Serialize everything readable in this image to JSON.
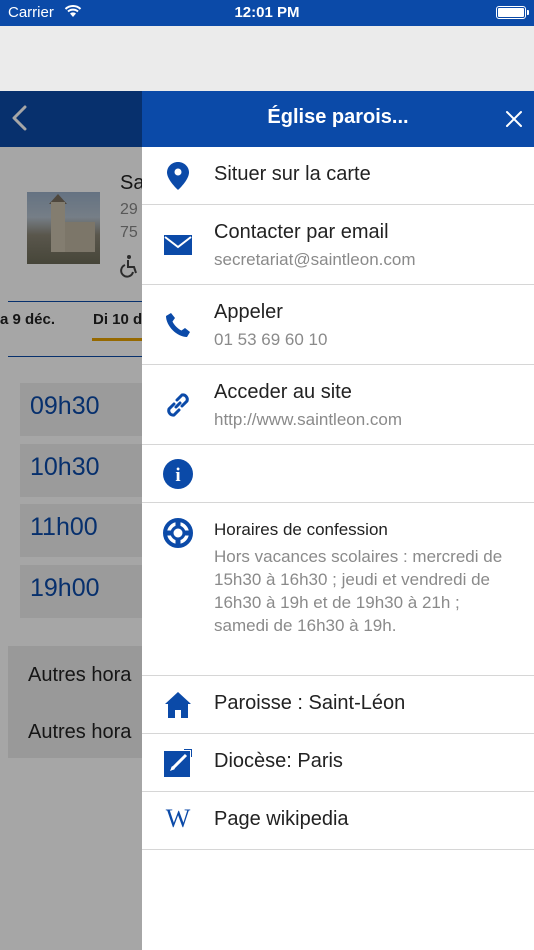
{
  "status_bar": {
    "carrier": "Carrier",
    "time": "12:01 PM"
  },
  "background": {
    "title_partial": "Sa",
    "addr_line1_partial": "29",
    "addr_line2_partial": "75",
    "tab_prev": "a 9 déc.",
    "tab_current": "Di 10 d",
    "times": [
      "09h30",
      "10h30",
      "11h00",
      "19h00"
    ],
    "other_rows": [
      "Autres hora",
      "Autres hora"
    ]
  },
  "drawer": {
    "title": "Église parois...",
    "items": [
      {
        "icon": "map-pin-icon",
        "label": "Situer sur la carte"
      },
      {
        "icon": "envelope-icon",
        "label": "Contacter par email",
        "sub": "secretariat@saintleon.com"
      },
      {
        "icon": "phone-icon",
        "label": "Appeler",
        "sub": "01 53 69 60 10"
      },
      {
        "icon": "link-icon",
        "label": "Acceder au site",
        "sub": "http://www.saintleon.com"
      },
      {
        "icon": "info-icon"
      },
      {
        "icon": "lifebuoy-icon",
        "label": "Horaires de confession",
        "sub": "Hors vacances scolaires : mercredi de 15h30 à 16h30 ; jeudi et vendredi de 16h30 à 19h et de 19h30 à 21h ; samedi de 16h30 à 19h."
      },
      {
        "icon": "home-icon",
        "label": "Paroisse : Saint-Léon"
      },
      {
        "icon": "edit-square-icon",
        "label": "Diocèse: Paris"
      },
      {
        "icon": "wikipedia-icon",
        "label": "Page wikipedia",
        "glyph": "W"
      }
    ]
  },
  "colors": {
    "brand": "#0b4aa8",
    "accent": "#e6a200"
  }
}
